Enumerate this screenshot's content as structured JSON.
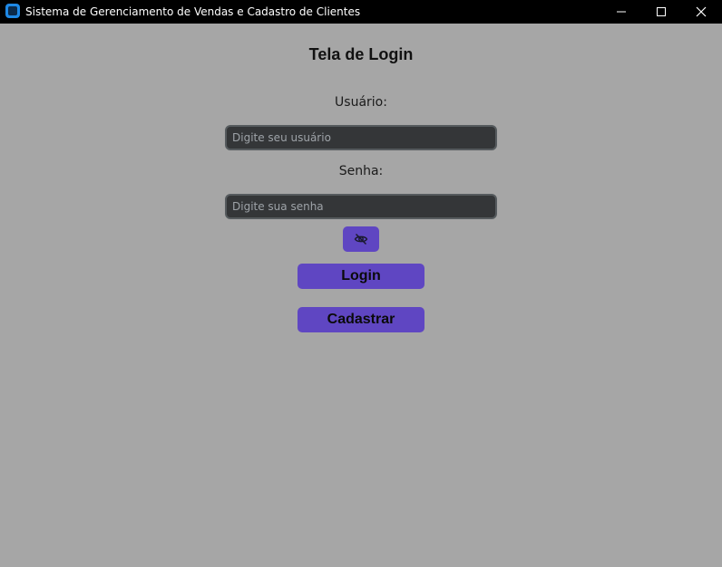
{
  "window": {
    "title": "Sistema de Gerenciamento de Vendas e Cadastro de Clientes",
    "icon": "app-icon",
    "controls": [
      "minimize-icon",
      "maximize-icon",
      "close-icon"
    ]
  },
  "login": {
    "heading": "Tela de Login",
    "user_label": "Usuário:",
    "user_placeholder": "Digite seu usuário",
    "user_value": "",
    "password_label": "Senha:",
    "password_placeholder": "Digite sua senha",
    "password_value": "",
    "toggle_icon": "eye-slash-icon",
    "login_button": "Login",
    "register_button": "Cadastrar"
  },
  "colors": {
    "background": "#a6a6a6",
    "titlebar": "#000000",
    "accent": "#5f46c2",
    "input_bg": "#343638",
    "input_border": "#565b5e"
  }
}
